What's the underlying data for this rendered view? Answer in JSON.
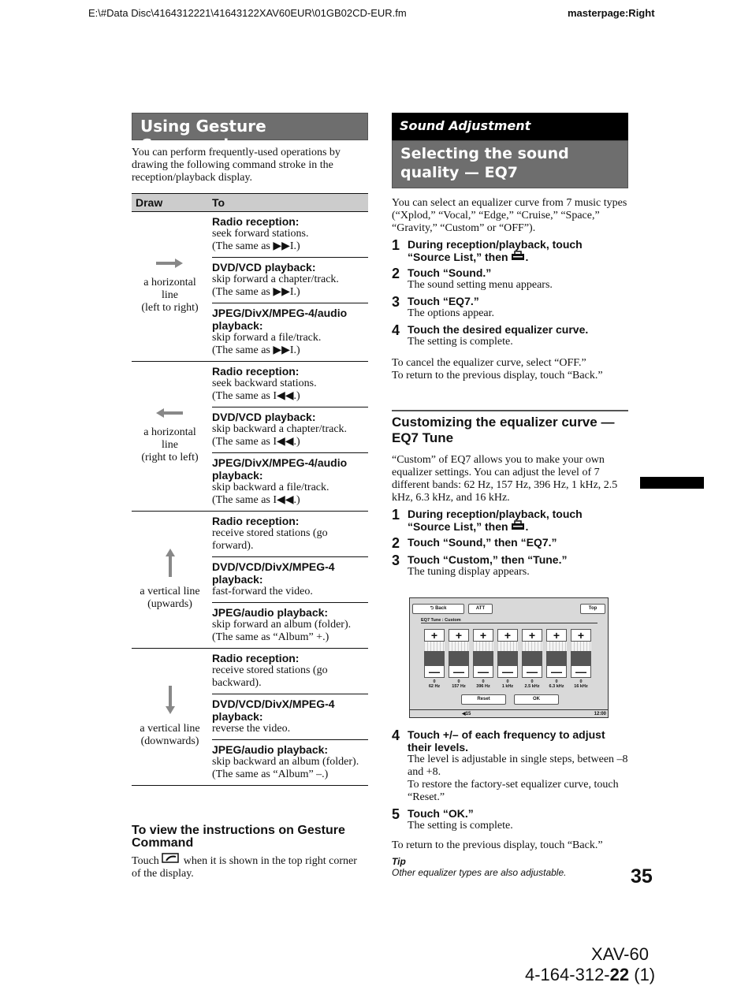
{
  "header": {
    "path": "E:\\#Data Disc\\4164312221\\41643122XAV60EUR\\01GB02CD-EUR.fm",
    "masterpage": "masterpage:Right"
  },
  "left": {
    "title": "Using Gesture Command",
    "intro": "You can perform frequently-used operations by drawing the following command stroke in the reception/playback display.",
    "table": {
      "headers": [
        "Draw",
        "To"
      ],
      "groups": [
        {
          "icon": "arrow-right-icon",
          "draw": [
            "a horizontal",
            "line",
            "(left to right)"
          ],
          "rows": [
            {
              "h": "Radio reception:",
              "t": [
                "seek forward stations.",
                "(The same as ▶▶I.)"
              ]
            },
            {
              "h": "DVD/VCD playback:",
              "t": [
                "skip forward a chapter/track.",
                "(The same as ▶▶I.)"
              ]
            },
            {
              "h": "JPEG/DivX/MPEG-4/audio playback:",
              "t": [
                "skip forward a file/track.",
                "(The same as ▶▶I.)"
              ]
            }
          ]
        },
        {
          "icon": "arrow-left-icon",
          "draw": [
            "a horizontal",
            "line",
            "(right to left)"
          ],
          "rows": [
            {
              "h": "Radio reception:",
              "t": [
                "seek backward stations.",
                "(The same as I◀◀.)"
              ]
            },
            {
              "h": "DVD/VCD playback:",
              "t": [
                "skip backward a chapter/track.",
                "(The same as I◀◀.)"
              ]
            },
            {
              "h": "JPEG/DivX/MPEG-4/audio playback:",
              "t": [
                "skip backward a file/track.",
                "(The same as I◀◀.)"
              ]
            }
          ]
        },
        {
          "icon": "arrow-up-icon",
          "draw": [
            "a vertical line",
            "(upwards)"
          ],
          "rows": [
            {
              "h": "Radio reception:",
              "t": [
                "receive stored stations (go forward)."
              ]
            },
            {
              "h": "DVD/VCD/DivX/MPEG-4 playback:",
              "t": [
                "fast-forward the video."
              ]
            },
            {
              "h": "JPEG/audio playback:",
              "t": [
                "skip forward an album (folder).",
                "(The same as “Album” +.)"
              ]
            }
          ]
        },
        {
          "icon": "arrow-down-icon",
          "draw": [
            "a vertical line",
            "(downwards)"
          ],
          "rows": [
            {
              "h": "Radio reception:",
              "t": [
                "receive stored stations (go backward)."
              ]
            },
            {
              "h": "DVD/VCD/DivX/MPEG-4 playback:",
              "t": [
                "reverse the video."
              ]
            },
            {
              "h": "JPEG/audio playback:",
              "t": [
                "skip backward an album (folder).",
                "(The same as “Album” –.)"
              ]
            }
          ]
        }
      ]
    },
    "view_title": "To view the instructions on Gesture Command",
    "view_text_a": "Touch",
    "view_text_b": "when it is shown in the top right corner of the display."
  },
  "right": {
    "section": "Sound Adjustment",
    "title": "Selecting the sound quality — EQ7",
    "intro": "You can select an equalizer curve from 7 music types (“Xplod,” “Vocal,” “Edge,” “Cruise,” “Space,” “Gravity,” “Custom” or “OFF”).",
    "steps1": [
      {
        "n": "1",
        "h": "During reception/playback, touch “Source List,” then",
        "t": ""
      },
      {
        "n": "2",
        "h": "Touch “Sound.”",
        "t": "The sound setting menu appears."
      },
      {
        "n": "3",
        "h": "Touch “EQ7.”",
        "t": "The options appear."
      },
      {
        "n": "4",
        "h": "Touch the desired equalizer curve.",
        "t": "The setting is complete."
      }
    ],
    "note1": "To cancel the equalizer curve, select “OFF.”",
    "note2": "To return to the previous display, touch “Back.”",
    "sub_title": "Customizing the equalizer curve — EQ7 Tune",
    "sub_intro": "“Custom” of EQ7 allows you to make your own equalizer settings. You can adjust the level of 7 different bands: 62 Hz, 157 Hz, 396 Hz, 1 kHz, 2.5 kHz, 6.3 kHz, and 16 kHz.",
    "steps2": [
      {
        "n": "1",
        "h": "During reception/playback, touch “Source List,” then",
        "t": ""
      },
      {
        "n": "2",
        "h": "Touch “Sound,” then “EQ7.”",
        "t": ""
      },
      {
        "n": "3",
        "h": "Touch “Custom,” then “Tune.”",
        "t": "The tuning display appears."
      }
    ],
    "screen": {
      "back": "Back",
      "att": "ATT",
      "top": "Top",
      "label": "EQ7 Tune : Custom",
      "bands": [
        {
          "v": "0",
          "f": "62 Hz"
        },
        {
          "v": "0",
          "f": "157 Hz"
        },
        {
          "v": "0",
          "f": "396 Hz"
        },
        {
          "v": "0",
          "f": "1 kHz"
        },
        {
          "v": "0",
          "f": "2.5 kHz"
        },
        {
          "v": "0",
          "f": "6.3 kHz"
        },
        {
          "v": "0",
          "f": "16 kHz"
        }
      ],
      "reset": "Reset",
      "ok": "OK",
      "volume": "15",
      "clock": "12:00"
    },
    "steps3": [
      {
        "n": "4",
        "h": "Touch +/– of each frequency to adjust their levels.",
        "t": "The level is adjustable in single steps, between –8 and +8.|To restore the factory-set equalizer curve, touch “Reset.”"
      },
      {
        "n": "5",
        "h": "Touch “OK.”",
        "t": "The setting is complete."
      }
    ],
    "note3": "To return to the previous display, touch “Back.”",
    "tip_label": "Tip",
    "tip": "Other equalizer types are also adjustable."
  },
  "page_number": "35",
  "footer": {
    "model": "XAV-60",
    "code_a": "4-164-312-",
    "code_b": "22",
    "code_c": " (1)"
  }
}
